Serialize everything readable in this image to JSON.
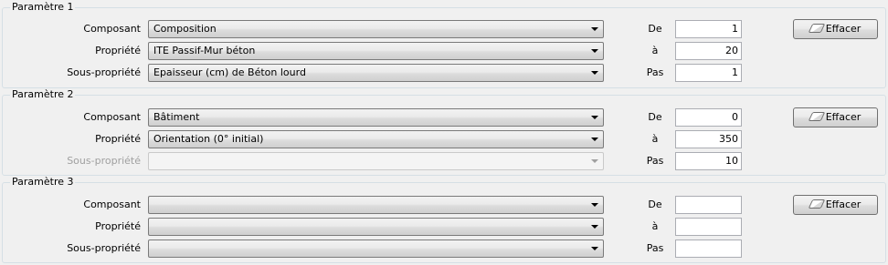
{
  "groups": [
    {
      "title": "Paramètre 1",
      "rows": [
        {
          "label": "Composant",
          "value": "Composition",
          "disabled": false,
          "range_label": "De",
          "range_value": "1"
        },
        {
          "label": "Propriété",
          "value": "ITE Passif-Mur béton",
          "disabled": false,
          "range_label": "à",
          "range_value": "20"
        },
        {
          "label": "Sous-propriété",
          "value": "Epaisseur (cm) de Béton lourd",
          "disabled": false,
          "range_label": "Pas",
          "range_value": "1"
        }
      ],
      "clear_label": "Effacer"
    },
    {
      "title": "Paramètre 2",
      "rows": [
        {
          "label": "Composant",
          "value": "Bâtiment",
          "disabled": false,
          "range_label": "De",
          "range_value": "0"
        },
        {
          "label": "Propriété",
          "value": "Orientation (0° initial)",
          "disabled": false,
          "range_label": "à",
          "range_value": "350"
        },
        {
          "label": "Sous-propriété",
          "value": "",
          "disabled": true,
          "range_label": "Pas",
          "range_value": "10"
        }
      ],
      "clear_label": "Effacer"
    },
    {
      "title": "Paramètre 3",
      "rows": [
        {
          "label": "Composant",
          "value": "",
          "disabled": false,
          "range_label": "De",
          "range_value": ""
        },
        {
          "label": "Propriété",
          "value": "",
          "disabled": false,
          "range_label": "à",
          "range_value": ""
        },
        {
          "label": "Sous-propriété",
          "value": "",
          "disabled": false,
          "range_label": "Pas",
          "range_value": ""
        }
      ],
      "clear_label": "Effacer"
    }
  ],
  "icons": {
    "clear": "eraser-icon"
  },
  "colors": {
    "background": "#f0f0f0",
    "disabled_text": "#a0a0a0",
    "group_border": "#d5dfe5"
  }
}
